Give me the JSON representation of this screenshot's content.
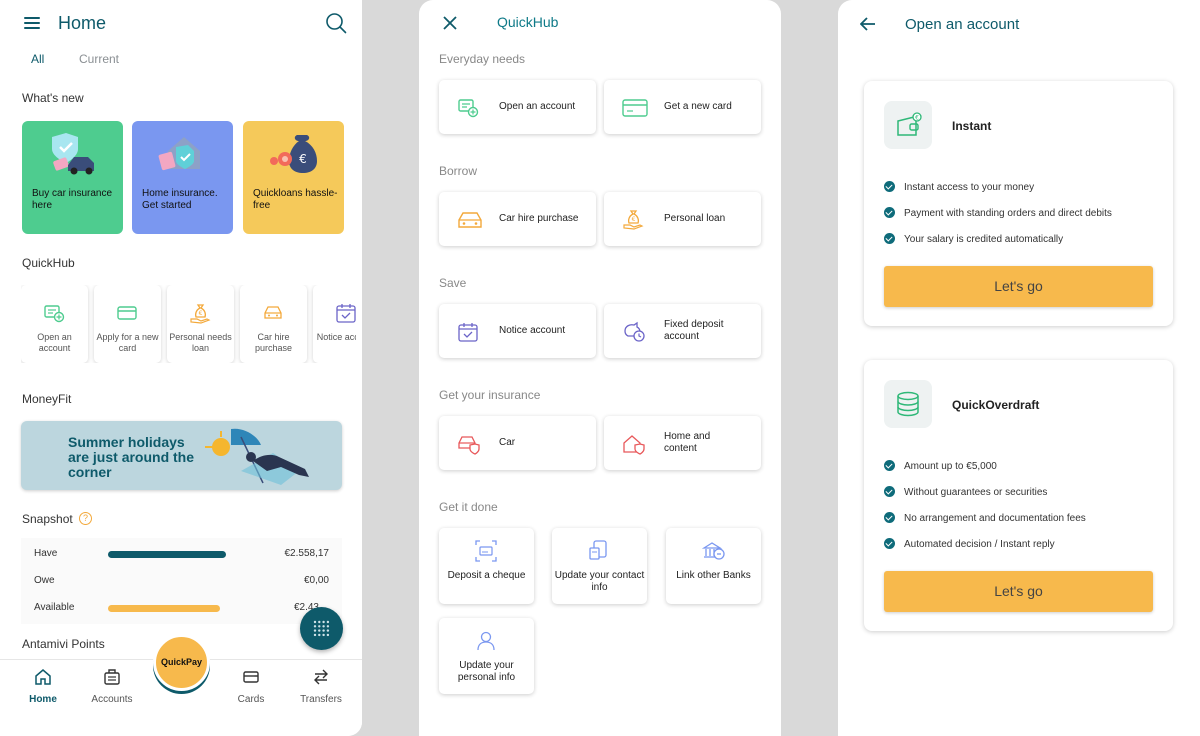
{
  "home": {
    "title": "Home",
    "tabs": [
      "All",
      "Current"
    ],
    "whats_new_label": "What's new",
    "whats_new_cards": [
      {
        "label": "Buy car insurance here",
        "color": "#4ecc8f"
      },
      {
        "label": "Home insurance. Get started",
        "color": "#7a97f0"
      },
      {
        "label": "Quickloans hassle-free",
        "color": "#f5c95a"
      }
    ],
    "quickhub_label": "QuickHub",
    "quickhub_tiles": [
      {
        "label": "Open an account",
        "icon": "open-account-icon"
      },
      {
        "label": "Apply for a new card",
        "icon": "card-icon"
      },
      {
        "label": "Personal needs loan",
        "icon": "loan-icon"
      },
      {
        "label": "Car hire purchase",
        "icon": "car-icon"
      },
      {
        "label": "Notice account",
        "icon": "calendar-icon"
      }
    ],
    "moneyfit_label": "MoneyFit",
    "banner_text": "Summer holidays are just around the corner",
    "snapshot_label": "Snapshot",
    "snapshot_info": "?",
    "snapshot": [
      {
        "name": "Have",
        "value": "€2.558,17",
        "fill": 0.9,
        "color": "#0e5a6a"
      },
      {
        "name": "Owe",
        "value": "€0,00",
        "fill": 0,
        "color": "#0e5a6a"
      },
      {
        "name": "Available",
        "value": "€2.43…",
        "fill": 0.88,
        "color": "#f7b94c"
      }
    ],
    "points_label": "Antamivi Points",
    "nav": [
      {
        "label": "Home",
        "icon": "home-icon",
        "active": true
      },
      {
        "label": "Accounts",
        "icon": "accounts-icon",
        "active": false
      },
      {
        "label": "Cards",
        "icon": "card-icon",
        "active": false
      },
      {
        "label": "Transfers",
        "icon": "transfers-icon",
        "active": false
      }
    ],
    "quickpay_label": "QuickPay"
  },
  "quickhub": {
    "title": "QuickHub",
    "sections": [
      {
        "label": "Everyday needs",
        "items": [
          "Open an account",
          "Get a new card"
        ]
      },
      {
        "label": "Borrow",
        "items": [
          "Car hire purchase",
          "Personal loan"
        ]
      },
      {
        "label": "Save",
        "items": [
          "Notice account",
          "Fixed deposit account"
        ]
      },
      {
        "label": "Get your insurance",
        "items": [
          "Car",
          "Home and content"
        ]
      },
      {
        "label": "Get it done",
        "items": [
          "Deposit a cheque",
          "Update your contact info",
          "Link other Banks",
          "Update your personal info"
        ]
      }
    ]
  },
  "open_account": {
    "title": "Open an account",
    "accounts": [
      {
        "name": "Instant",
        "icon": "wallet-euro-icon",
        "features": [
          "Instant access to your money",
          "Payment with standing orders and direct debits",
          "Your salary is credited automatically"
        ],
        "button": "Let's go"
      },
      {
        "name": "QuickOverdraft",
        "icon": "coins-stack-icon",
        "features": [
          "Amount up to €5,000",
          "Without guarantees or securities",
          "No arrangement and documentation fees",
          "Automated decision / Instant reply"
        ],
        "button": "Let's go"
      }
    ]
  }
}
